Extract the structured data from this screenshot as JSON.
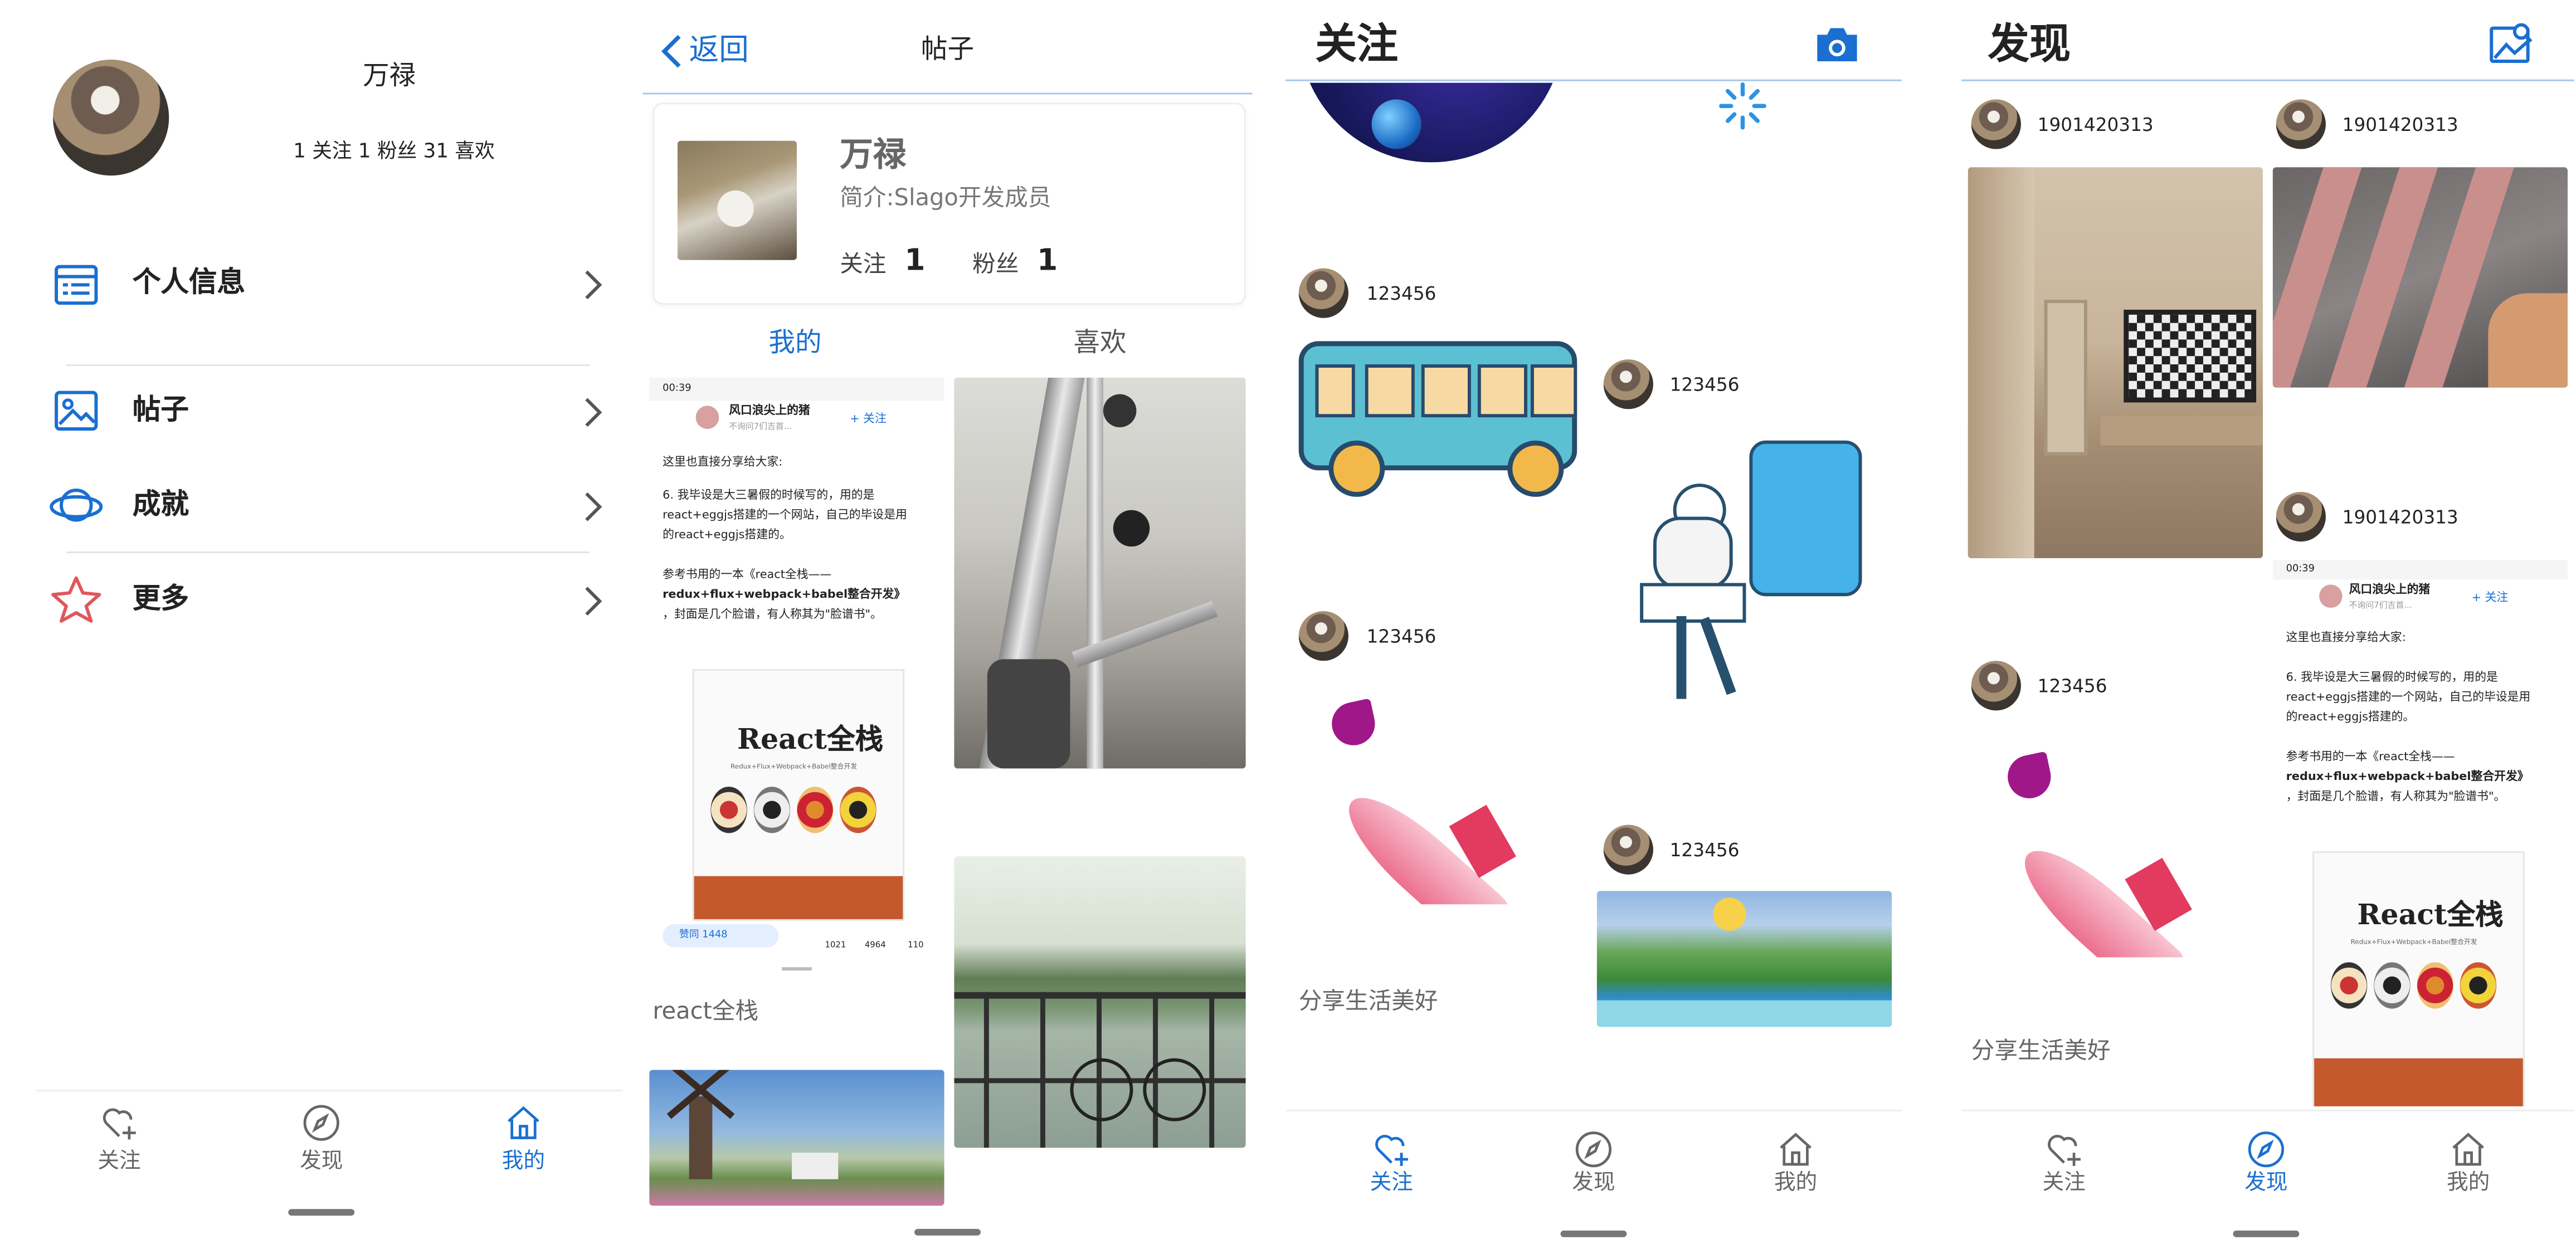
{
  "colors": {
    "accent": "#1a6fd1",
    "divider": "#e3e3e3",
    "tabbar_inactive": "#666666",
    "star_icon": "#e0575b"
  },
  "profile_screen": {
    "username": "万禄",
    "stats": "1 关注 1 粉丝 31 喜欢",
    "menu": [
      {
        "label": "个人信息",
        "icon": "profile-card-icon"
      },
      {
        "label": "帖子",
        "icon": "image-icon"
      },
      {
        "label": "成就",
        "icon": "planet-icon"
      },
      {
        "label": "更多",
        "icon": "star-icon"
      }
    ]
  },
  "posts_screen": {
    "back_label": "返回",
    "title": "帖子",
    "card": {
      "name": "万禄",
      "bio": "简介:Slago开发成员",
      "following_label": "关注",
      "following_count": "1",
      "followers_label": "粉丝",
      "followers_count": "1"
    },
    "tabs": [
      {
        "label": "我的",
        "active": true
      },
      {
        "label": "喜欢",
        "active": false
      }
    ],
    "post_caption": "react全栈"
  },
  "screenshot_post": {
    "time": "00:39",
    "author": "风口浪尖上的猪",
    "author_sub": "不询问7们吉首...",
    "follow": "+ 关注",
    "line1": "这里也直接分享给大家:",
    "line2": "6. 我毕设是大三暑假的时候写的，用的是",
    "line3": "react+eggjs搭建的一个网站，自己的毕设是用",
    "line4": "的react+eggjs搭建的。",
    "line5": "参考书用的一本《react全栈——",
    "line6": "redux+flux+webpack+babel整合开发》",
    "line7": "，封面是几个脸谱，有人称其为\"脸谱书\"。",
    "book_title": "React全栈",
    "book_sub": "Redux+Flux+Webpack+Babel整合开发",
    "like_btn": "赞同 1448",
    "c1": "1021",
    "c2": "4964",
    "c3": "110"
  },
  "following_screen": {
    "title": "关注",
    "users": [
      "123456",
      "123456",
      "123456",
      "123456"
    ],
    "caption": "分享生活美好"
  },
  "discover_screen": {
    "title": "发现",
    "users": [
      "1901420313",
      "1901420313",
      "1901420313",
      "123456"
    ],
    "caption": "分享生活美好"
  },
  "tabbar": {
    "follow": "关注",
    "discover": "发现",
    "mine": "我的"
  }
}
